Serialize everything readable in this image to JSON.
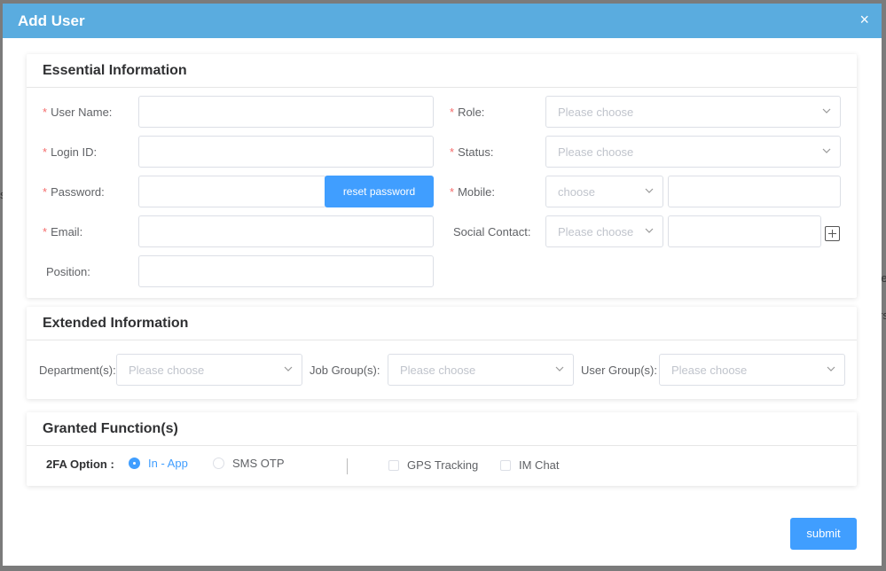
{
  "dialog": {
    "title": "Add User",
    "close_symbol": "×"
  },
  "backdrop": {
    "frag1": "s",
    "frag2": "re",
    "frag3": "rs"
  },
  "essential": {
    "heading": "Essential Information",
    "required_mark": "*",
    "user_name_label": "User Name:",
    "login_id_label": "Login ID:",
    "password_label": "Password:",
    "reset_password_label": "reset password",
    "email_label": "Email:",
    "position_label": "Position:",
    "role_label": "Role:",
    "role_placeholder": "Please choose",
    "status_label": "Status:",
    "status_placeholder": "Please choose",
    "mobile_label": "Mobile:",
    "mobile_code_placeholder": "choose",
    "social_label": "Social Contact:",
    "social_placeholder": "Please choose"
  },
  "extended": {
    "heading": "Extended Information",
    "department_label": "Department(s):",
    "department_placeholder": "Please choose",
    "job_group_label": "Job Group(s):",
    "job_group_placeholder": "Please choose",
    "user_group_label": "User Group(s):",
    "user_group_placeholder": "Please choose"
  },
  "granted": {
    "heading": "Granted Function(s)",
    "twofa_label": "2FA Option :",
    "twofa_options": [
      {
        "label": "In - App",
        "selected": true
      },
      {
        "label": "SMS OTP",
        "selected": false
      }
    ],
    "gps_label": "GPS Tracking",
    "gps_checked": false,
    "im_label": "IM Chat",
    "im_checked": false
  },
  "footer": {
    "submit_label": "submit"
  },
  "icons": [
    "close-icon",
    "chevron-down-icon",
    "plus-square-icon",
    "radio-icon",
    "checkbox-icon"
  ],
  "colors": {
    "title_bar": "#5aacdf",
    "primary": "#409eff",
    "required": "#f56c6c"
  }
}
